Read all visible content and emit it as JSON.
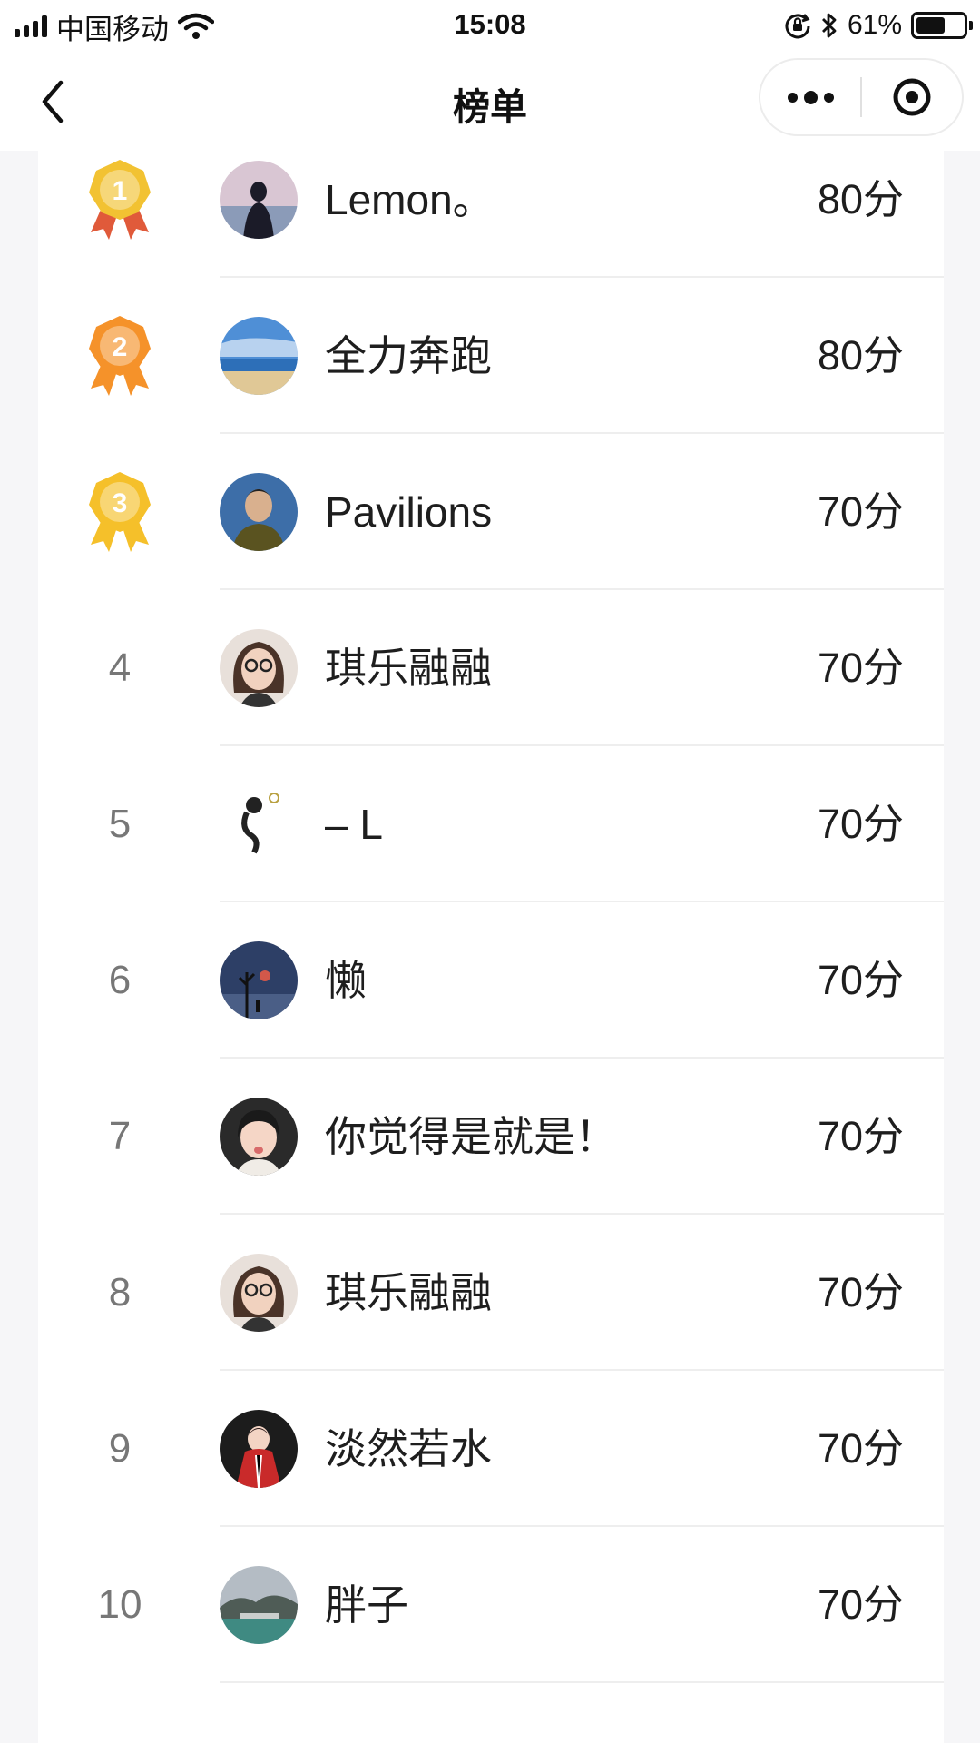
{
  "status_bar": {
    "carrier": "中国移动",
    "time": "15:08",
    "battery_percent": "61%",
    "battery_level": 0.61
  },
  "nav": {
    "title": "榜单"
  },
  "leaderboard": [
    {
      "rank": "1",
      "name": "Lemon。",
      "score": "80分",
      "medal_color": "#f2c232",
      "ribbon_color": "#e05a3a"
    },
    {
      "rank": "2",
      "name": "全力奔跑",
      "score": "80分",
      "medal_color": "#f5922a",
      "ribbon_color": "#f5922a"
    },
    {
      "rank": "3",
      "name": "Pavilions",
      "score": "70分",
      "medal_color": "#f5c02a",
      "ribbon_color": "#f5c02a"
    },
    {
      "rank": "4",
      "name": "琪乐融融",
      "score": "70分"
    },
    {
      "rank": "5",
      "name": "– L",
      "score": "70分"
    },
    {
      "rank": "6",
      "name": "懒",
      "score": "70分"
    },
    {
      "rank": "7",
      "name": "你觉得是就是！",
      "score": "70分"
    },
    {
      "rank": "8",
      "name": "琪乐融融",
      "score": "70分"
    },
    {
      "rank": "9",
      "name": "淡然若水",
      "score": "70分"
    },
    {
      "rank": "10",
      "name": "胖子",
      "score": "70分"
    }
  ]
}
